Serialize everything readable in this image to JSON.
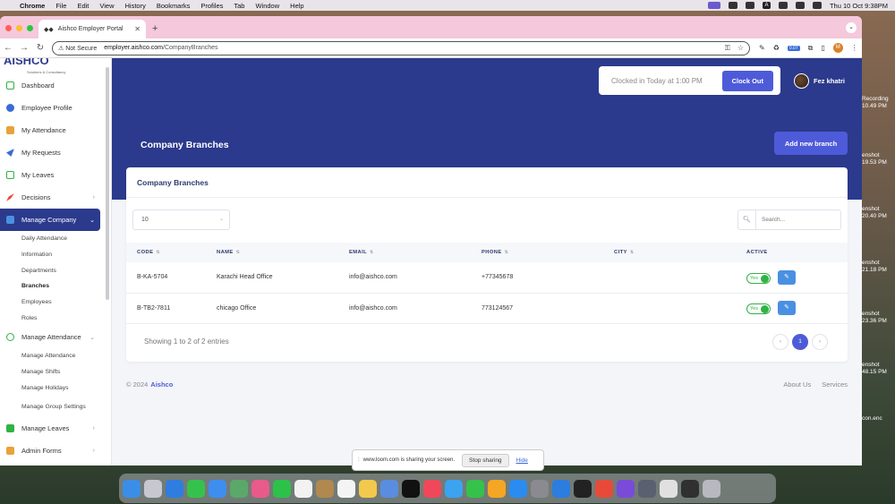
{
  "menubar": {
    "app_name": "Chrome",
    "menus": [
      "File",
      "Edit",
      "View",
      "History",
      "Bookmarks",
      "Profiles",
      "Tab",
      "Window",
      "Help"
    ],
    "clock": "Thu 10 Oct  9:38PM"
  },
  "desktop_labels": [
    "Recording",
    "10.49 PM",
    "enshot",
    "19.53 PM",
    "enshot",
    "20.40 PM",
    "enshot",
    "21.18 PM",
    "enshot",
    "23.36 PM",
    "enshot",
    "48.15 PM",
    "con.enc"
  ],
  "browser": {
    "tab_title": "Aishco Employer Portal",
    "security_label": "Not Secure",
    "url_host": "employer.aishco.com",
    "url_path": "/CompanyBranches",
    "extension_badge": "0.07",
    "profile_initial": "M"
  },
  "sidebar": {
    "logo": "AISHCO",
    "logo_sub": "Solutions & Consultancy",
    "items": [
      {
        "label": "Dashboard",
        "color": "#2fb344"
      },
      {
        "label": "Employee Profile",
        "color": "#3b6bd6"
      },
      {
        "label": "My Attendance",
        "color": "#e8a23b"
      },
      {
        "label": "My Requests",
        "color": "#3b6bd6"
      },
      {
        "label": "My Leaves",
        "color": "#2fb344"
      },
      {
        "label": "Decisions",
        "color": "#e84b3b"
      },
      {
        "label": "Manage Company",
        "color": "#4a90e2"
      }
    ],
    "company_sub": [
      "Daily Attendance",
      "Information",
      "Departments",
      "Branches",
      "Employees",
      "Roles"
    ],
    "attendance_item": "Manage Attendance",
    "attendance_sub": [
      "Manage Attendance",
      "Manage Shifts",
      "Manage Holidays",
      "Manage Group Settings"
    ],
    "leaves_item": "Manage Leaves",
    "admin_item": "Admin Forms"
  },
  "header": {
    "clock_text": "Clocked in Today at 1:00 PM",
    "clock_out_label": "Clock Out",
    "user_name": "Fez khatri",
    "page_title": "Company Branches",
    "add_button": "Add new branch"
  },
  "card": {
    "title": "Company Branches",
    "page_length": "10",
    "search_placeholder": "Search...",
    "columns": [
      "CODE",
      "NAME",
      "EMAIL",
      "PHONE",
      "CITY",
      "ACTIVE"
    ],
    "rows": [
      {
        "code": "B-KA-5704",
        "name": "Karachi Head Office",
        "email": "info@aishco.com",
        "phone": "+77345678",
        "city": "",
        "active": "Yes"
      },
      {
        "code": "B-TB2-7811",
        "name": "chicago Office",
        "email": "info@aishco.com",
        "phone": "773124567",
        "city": "",
        "active": "Yes"
      }
    ],
    "showing": "Showing 1 to 2 of 2 entries",
    "current_page": "1"
  },
  "footer": {
    "copyright": "© 2024",
    "brand": "Aishco",
    "links": [
      "About Us",
      "Services"
    ]
  },
  "loom": {
    "message": "www.loom.com is sharing your screen.",
    "stop": "Stop sharing",
    "hide": "Hide"
  }
}
